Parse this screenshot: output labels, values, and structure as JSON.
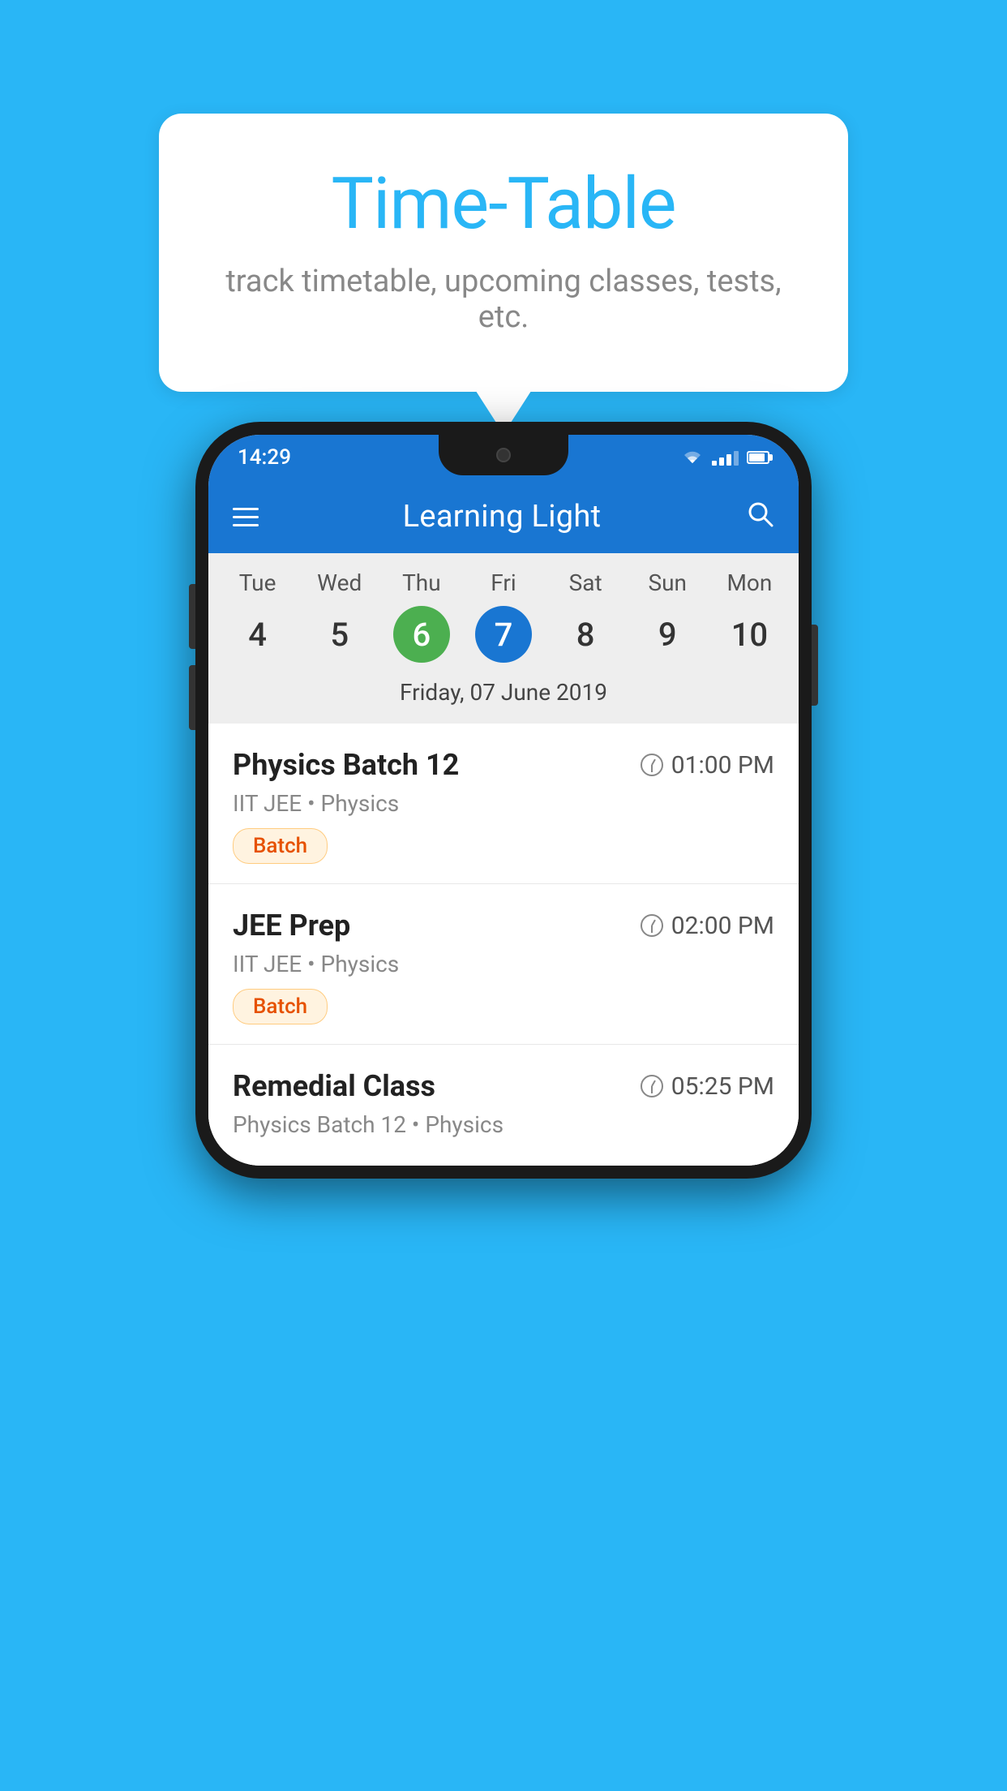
{
  "page": {
    "background_color": "#29B6F6"
  },
  "hero": {
    "title": "Time-Table",
    "subtitle": "track timetable, upcoming classes, tests, etc."
  },
  "status_bar": {
    "time": "14:29"
  },
  "app_bar": {
    "title": "Learning Light"
  },
  "calendar": {
    "days": [
      "Tue",
      "Wed",
      "Thu",
      "Fri",
      "Sat",
      "Sun",
      "Mon"
    ],
    "dates": [
      "4",
      "5",
      "6",
      "7",
      "8",
      "9",
      "10"
    ],
    "today_index": 2,
    "selected_index": 3,
    "selected_date_label": "Friday, 07 June 2019"
  },
  "schedule": [
    {
      "title": "Physics Batch 12",
      "time": "01:00 PM",
      "sub": "IIT JEE • Physics",
      "tag": "Batch"
    },
    {
      "title": "JEE Prep",
      "time": "02:00 PM",
      "sub": "IIT JEE • Physics",
      "tag": "Batch"
    },
    {
      "title": "Remedial Class",
      "time": "05:25 PM",
      "sub": "Physics Batch 12 • Physics",
      "tag": ""
    }
  ]
}
